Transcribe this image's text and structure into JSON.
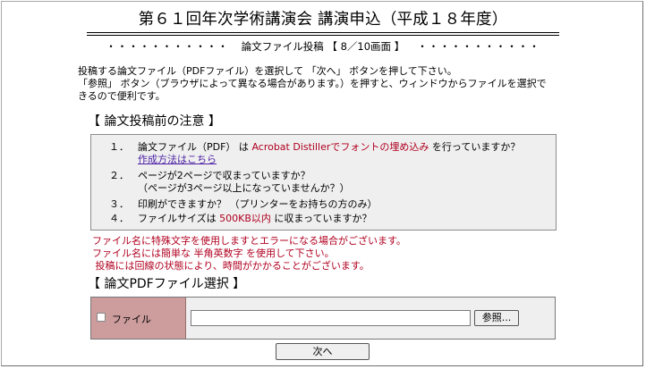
{
  "header": {
    "title": "第６１回年次学術講演会  講演申込（平成１８年度）",
    "subtitle_dots_left": "・・・・・・・・・・・",
    "subtitle_text": "論文ファイル投稿 【 8／10画面 】",
    "subtitle_dots_right": "・・・・・・・・・・・"
  },
  "intro": {
    "line1": "投稿する論文ファイル（PDFファイル）を選択して 「次へ」 ボタンを押して下さい。",
    "line2": "「参照」 ボタン（ブラウザによって異なる場合があります。）を押すと、ウィンドウからファイルを選択で",
    "line3": "きるので便利です。"
  },
  "notice": {
    "heading": "【 論文投稿前の注意 】",
    "items": [
      {
        "num": "１．",
        "text_before": "論文ファイル（PDF） は ",
        "highlight": "Acrobat Distillerでフォントの埋め込み",
        "text_after": " を行っていますか？",
        "link": "作成方法はこちら"
      },
      {
        "num": "２．",
        "text": "ページが2ページで収まっていますか？",
        "sub": "（ページが3ページ以上になっていませんか？）"
      },
      {
        "num": "３．",
        "text": "印刷ができますか？ （プリンターをお持ちの方のみ）"
      },
      {
        "num": "４．",
        "text_before": "ファイルサイズは ",
        "highlight": "500KB以内",
        "text_after": " に収まっていますか？"
      }
    ]
  },
  "warnings": [
    "ファイル名に特殊文字を使用しますとエラーになる場合がございます。",
    "ファイル名には簡単な 半角英数字 を使用して下さい。",
    " 投稿には回線の状態により、時間がかかることがございます。"
  ],
  "file_section": {
    "heading": "【 論文PDFファイル選択 】",
    "label": "ファイル",
    "input_value": "",
    "browse_label": "参照..."
  },
  "next_button": "次へ",
  "colors": {
    "highlight_red": "#b00020",
    "link_purple": "#4b1fa5",
    "label_cell": "#cd9d9d",
    "box_bg": "#efefef"
  }
}
